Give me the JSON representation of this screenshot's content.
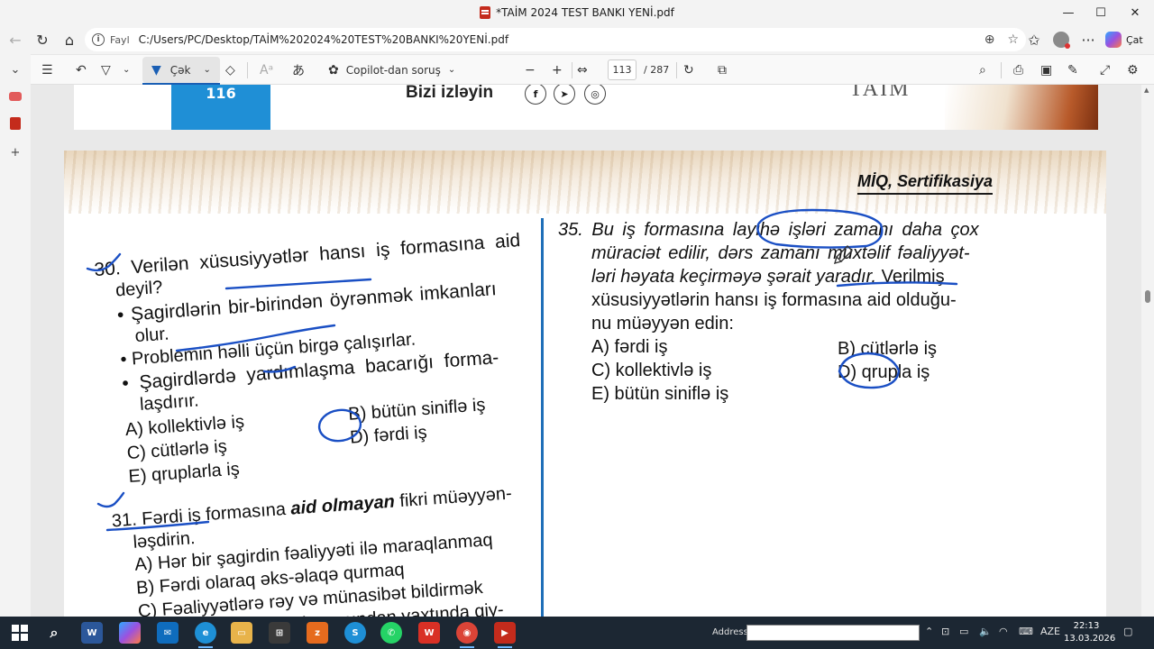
{
  "window": {
    "title": "*TAİM 2024 TEST BANKI YENİ.pdf",
    "minimize": "—",
    "maximize": "☐",
    "close": "✕"
  },
  "address_bar": {
    "scheme_label": "Fayl",
    "url": "C:/Users/PC/Desktop/TAİM%202024%20TEST%20BANKI%20YENİ.pdf",
    "copilot_label": "Çat"
  },
  "pdf_toolbar": {
    "draw_label": "Çək",
    "copilot_label": "Copilot-dan soruş",
    "current_page": "113",
    "total_pages": "/ 287"
  },
  "prev_page": {
    "page_number": "116",
    "follow_text": "Bizi izləyin",
    "logo_text": "TAİM"
  },
  "page": {
    "section_title": "MİQ, Sertifikasiya",
    "q30": {
      "lines": [
        "30. Verilən xüsusiyyətlər hansı iş formasına aid",
        "deyil?",
        "•  Şagirdlərin bir-birindən öyrənmək imkanları",
        "olur.",
        "•  Problemin həlli üçün birgə çalışırlar.",
        "•  Şagirdlərdə yardımlaşma bacarığı forma-",
        "laşdırır."
      ],
      "options": {
        "a": "A) kollektivlə iş",
        "b": "B) bütün siniflə iş",
        "c": "C) cütlərlə iş",
        "d": "D) fərdi iş",
        "e": "E) qruplarla iş"
      }
    },
    "q31": {
      "lines": [
        "31. Fərdi iş formasına",
        "aid olmayan",
        "fikri müəyyən-",
        "ləşdirin.",
        "A) Hər bir şagirdin fəaliyyəti ilə maraqlanmaq",
        "B) Fərdi olaraq əks-əlaqə qurmaq",
        "C) Fəaliyyətlərə rəy və münasibət bildirmək",
        "D) Fəaliyyətləri vaxt baxımından vaxtında qiy-"
      ]
    },
    "q35": {
      "lines": [
        "35. Bu iş formasına layihə işləri zamanı daha çox",
        "müraciət edilir, dərs zamanı müxtəlif fəaliyyət-",
        "ləri həyata keçirməyə şərait yaradır.",
        "Verilmiş",
        "xüsusiyyətlərin hansı iş formasına aid olduğu-",
        "nu müəyyən edin:"
      ],
      "options": {
        "a": "A) fərdi iş",
        "b": "B) cütlərlə iş",
        "c": "C) kollektivlə iş",
        "d": "D) qrupla iş",
        "e": "E) bütün siniflə iş"
      }
    }
  },
  "taskbar": {
    "address_label": "Address",
    "language": "AZE",
    "time": "22:13",
    "date": "13.03.2026"
  },
  "colors": {
    "ink": "#1a4fc4",
    "divider": "#1f6fb8",
    "accent": "#1a5fb4"
  }
}
